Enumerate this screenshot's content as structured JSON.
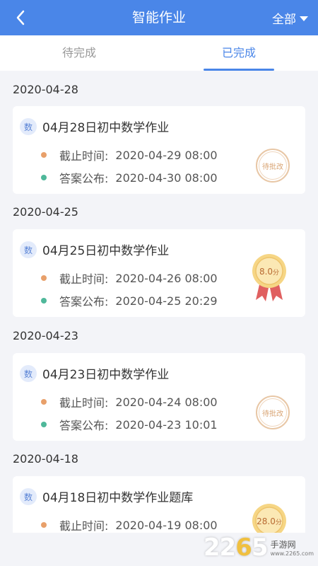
{
  "header": {
    "title": "智能作业",
    "filter_label": "全部"
  },
  "tabs": [
    {
      "label": "待完成"
    },
    {
      "label": "已完成"
    }
  ],
  "groups": [
    {
      "date": "2020-04-28",
      "subject": "数",
      "title": "04月28日初中数学作业",
      "deadline_label": "截止时间:",
      "deadline": "2020-04-29 08:00",
      "answer_label": "答案公布:",
      "answer_time": "2020-04-30 08:00",
      "status": "待批改"
    },
    {
      "date": "2020-04-25",
      "subject": "数",
      "title": "04月25日初中数学作业",
      "deadline_label": "截止时间:",
      "deadline": "2020-04-26 08:00",
      "answer_label": "答案公布:",
      "answer_time": "2020-04-25 20:29",
      "score": "8.0",
      "score_unit": "分"
    },
    {
      "date": "2020-04-23",
      "subject": "数",
      "title": "04月23日初中数学作业",
      "deadline_label": "截止时间:",
      "deadline": "2020-04-24 08:00",
      "answer_label": "答案公布:",
      "answer_time": "2020-04-23 10:01",
      "status": "待批改"
    },
    {
      "date": "2020-04-18",
      "subject": "数",
      "title": "04月18日初中数学作业题库",
      "deadline_label": "截止时间:",
      "deadline": "2020-04-19 08:00",
      "score": "28.0",
      "score_unit": "分"
    }
  ],
  "watermark": {
    "number_a": "22",
    "number_b": "6",
    "number_c": "5",
    "brand": "手游网",
    "url": "www.2265.com"
  },
  "colors": {
    "primary": "#4a86e8",
    "deadline_dot": "#e8a06a",
    "answer_dot": "#4fb89a",
    "medal": "#f4c46a"
  }
}
